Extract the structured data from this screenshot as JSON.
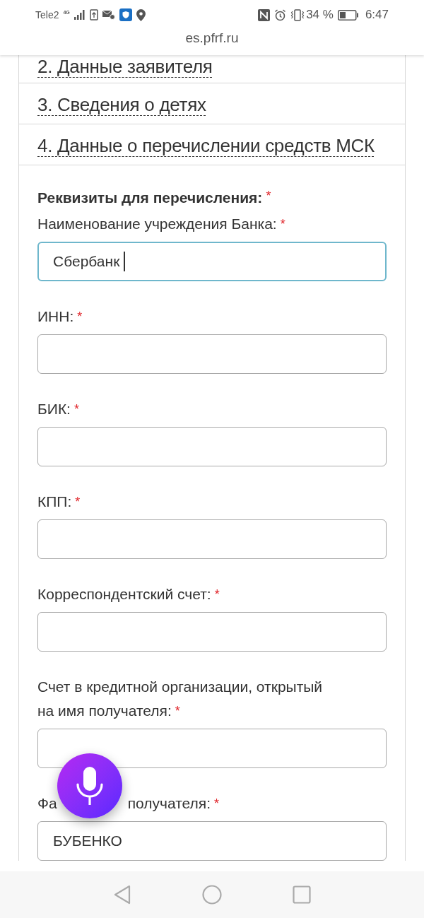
{
  "status_bar": {
    "carrier": "Tele2",
    "network": "4G",
    "battery": "34 %",
    "time": "6:47"
  },
  "url": "es.pfrf.ru",
  "sections": [
    {
      "title": "2. Данные заявителя"
    },
    {
      "title": "3. Сведения о детях"
    },
    {
      "title": "4. Данные о перечислении средств МСК"
    }
  ],
  "form": {
    "heading": "Реквизиты для перечисления:",
    "required_mark": "*",
    "fields": [
      {
        "label": "Наименование учреждения Банка:",
        "required_mark": "*",
        "value": "Сбербанк",
        "focused": true
      },
      {
        "label": "ИНН:",
        "required_mark": "*",
        "focused": false
      },
      {
        "label": "БИК:",
        "required_mark": "*",
        "focused": false
      },
      {
        "label": "КПП:",
        "required_mark": "*",
        "focused": false
      },
      {
        "label": "Корреспондентский счет:",
        "required_mark": "*",
        "focused": false
      },
      {
        "label_lines": [
          "Счет в кредитной организации, открытый",
          "на имя получателя:"
        ],
        "required_mark": "*",
        "focused": false
      },
      {
        "label_parts": [
          "Фа",
          "получателя:"
        ],
        "required_mark": "*",
        "value": "БУБЕНКО",
        "focused": false
      }
    ]
  }
}
